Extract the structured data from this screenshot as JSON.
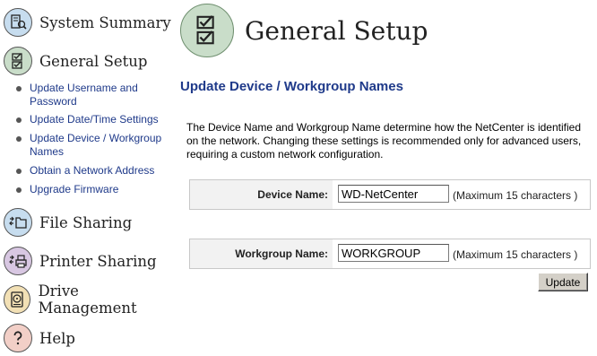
{
  "sidebar": {
    "main_items": [
      {
        "label": "System Summary",
        "icon": "system-summary-icon",
        "color": "#c7ddef"
      },
      {
        "label": "General Setup",
        "icon": "checklist-icon",
        "color": "#c9ddc9"
      },
      {
        "label": "File Sharing",
        "icon": "file-sharing-icon",
        "color": "#c7ddef"
      },
      {
        "label": "Printer Sharing",
        "icon": "printer-sharing-icon",
        "color": "#d8c7e2"
      },
      {
        "label": "Drive Management",
        "icon": "drive-icon",
        "color": "#f2e0b5"
      },
      {
        "label": "Help",
        "icon": "help-icon",
        "color": "#f2cfc7"
      }
    ],
    "sub_items": [
      {
        "label": "Update Username and Password"
      },
      {
        "label": "Update Date/Time Settings"
      },
      {
        "label": "Update Device / Workgroup Names"
      },
      {
        "label": "Obtain a Network Address"
      },
      {
        "label": "Upgrade Firmware"
      }
    ]
  },
  "main": {
    "title": "General Setup",
    "section_heading": "Update Device / Workgroup Names",
    "description": "The Device Name and Workgroup Name determine how the NetCenter is identified on the network. Changing these settings is recommended only for advanced users, requiring a custom network configuration.",
    "device_name": {
      "label": "Device Name:",
      "value": "WD-NetCenter",
      "hint": "(Maximum 15 characters )"
    },
    "workgroup_name": {
      "label": "Workgroup Name:",
      "value": "WORKGROUP",
      "hint": "(Maximum 15 characters )"
    },
    "update_label": "Update"
  }
}
